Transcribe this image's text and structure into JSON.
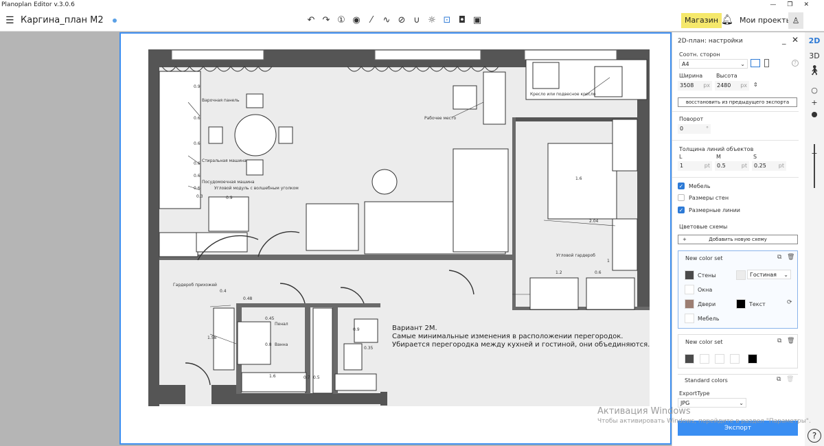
{
  "app": {
    "title": "Planoplan Editor v.3.0.6",
    "project_title": "Каргина_план М2"
  },
  "topbar": {
    "shop_label": "Магазин",
    "my_projects_label": "Мои проекты"
  },
  "rightrail": {
    "view_2d": "2D",
    "view_3d": "3D"
  },
  "panel": {
    "title": "2D-план: настройки",
    "aspect_label": "Соотн. сторон",
    "aspect_value": "A4",
    "width_label": "Ширина",
    "height_label": "Высота",
    "width_value": "3508",
    "height_value": "2480",
    "px": "px",
    "restore_label": "восстановить из предыдущего экспорта",
    "rotation_label": "Поворот",
    "rotation_value": "0",
    "rotation_unit": "°",
    "line_thickness_label": "Толщина линий объектов",
    "l_label": "L",
    "m_label": "M",
    "s_label": "S",
    "l_value": "1",
    "m_value": "0.5",
    "s_value": "0.25",
    "pt": "pt",
    "furniture_label": "Мебель",
    "wall_sizes_label": "Размеры стен",
    "dim_lines_label": "Размерные линии",
    "color_schemes_label": "Цветовые схемы",
    "add_scheme_label": "Добавить новую схему",
    "set1_title": "New color set",
    "walls_label": "Стены",
    "windows_label": "Окна",
    "doors_label": "Двери",
    "furniture_color_label": "Мебель",
    "text_label": "Текст",
    "room_select_value": "Гостиная",
    "set2_title": "New color set",
    "standard_label": "Standard colors",
    "export_type_label": "ExportType",
    "export_type_value": "JPG",
    "export_button": "Экспорт",
    "colors": {
      "walls": "#4a4a4a",
      "room": "#ececec",
      "windows": "#ffffff",
      "doors": "#9c7e72",
      "furniture": "#ffffff",
      "text": "#000000",
      "accent": "#3a8ef2"
    }
  },
  "plan": {
    "labels": {
      "hob": "Варочная панель",
      "washer": "Стиральная машина",
      "dishwasher": "Посудомоечная машина",
      "corner_module": "Угловой модуль с волшебным уголком",
      "workplace": "Рабочее место",
      "armchair": "Кресло или подвесное кресло",
      "wardrobe_corner": "Угловой гардероб",
      "hall_wardrobe": "Гардероб прихожей",
      "dryer": "Пенал",
      "bath": "Ванна"
    },
    "dims": {
      "d09a": "0.9",
      "d06a": "0.6",
      "d06b": "0.6",
      "d06c": "0.6",
      "d06d": "0.6",
      "d06e": "0.6",
      "d03": "0.3",
      "d09": "0.9",
      "d16": "1.6",
      "d204": "2.04",
      "d12": "1.2",
      "d06f": "0.6",
      "d1": "1",
      "d04": "0.4",
      "d048": "0.48",
      "d158": "1.58",
      "d045": "0.45",
      "d08": "0.8",
      "d16b": "1.6",
      "d07": "0.7",
      "d05": "0.5",
      "d09b": "0.9",
      "d035": "0.35"
    },
    "note_title": "Вариант 2М.",
    "note_text": "Самые минимальные изменения в расположении перегородок. Убирается перегородка между кухней и гостиной, они объединяются."
  },
  "watermark": {
    "line1": "Активация Windows",
    "line2": "Чтобы активировать Windows, перейдите в раздел \"Параметры\"."
  }
}
